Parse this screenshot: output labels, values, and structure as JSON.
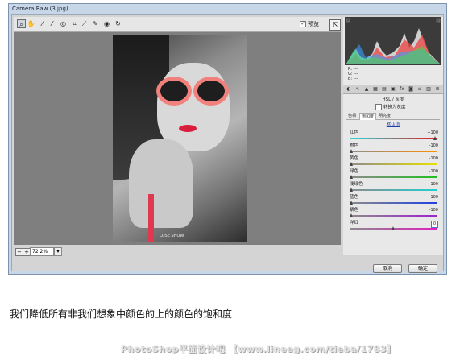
{
  "window": {
    "title": "Camera Raw (3.jpg)"
  },
  "toolbar": {
    "tools": [
      "zoom-tool",
      "hand-tool",
      "white-balance-tool",
      "color-sampler-tool",
      "target-adjust-tool",
      "crop-tool",
      "straighten-tool",
      "red-eye-tool",
      "spot-removal-tool",
      "rotate-tool"
    ],
    "preview_label": "预览",
    "preview_checked": true
  },
  "photo": {
    "caption": "LOSE SHOW"
  },
  "zoom": {
    "value": "72.2%"
  },
  "histogram": {
    "r_label": "R:",
    "g_label": "G:",
    "b_label": "B:",
    "r_value": "---",
    "g_value": "---",
    "b_value": "---"
  },
  "panel": {
    "title": "HSL / 灰度",
    "convert_gray_label": "转换为灰度",
    "subtabs": [
      "色相",
      "饱和度",
      "明亮度"
    ],
    "active_subtab": 1,
    "default_link": "默认值",
    "sliders": [
      {
        "name": "红色",
        "value": "+100",
        "position": 1.0,
        "colors": [
          "#2bd6d6",
          "#e02020"
        ]
      },
      {
        "name": "橙色",
        "value": "-100",
        "position": 0.0,
        "colors": [
          "#8c8c8c",
          "#ff8c00"
        ]
      },
      {
        "name": "黄色",
        "value": "-100",
        "position": 0.0,
        "colors": [
          "#8c8c8c",
          "#e8e000"
        ]
      },
      {
        "name": "绿色",
        "value": "-100",
        "position": 0.0,
        "colors": [
          "#8c8c8c",
          "#20c020"
        ]
      },
      {
        "name": "浅绿色",
        "value": "-100",
        "position": 0.0,
        "colors": [
          "#8c8c8c",
          "#20d0d0"
        ]
      },
      {
        "name": "蓝色",
        "value": "-100",
        "position": 0.0,
        "colors": [
          "#8c8c8c",
          "#2040e0"
        ]
      },
      {
        "name": "紫色",
        "value": "-100",
        "position": 0.0,
        "colors": [
          "#8c8c8c",
          "#a020d0"
        ]
      },
      {
        "name": "洋红",
        "value": "0",
        "position": 0.5,
        "colors": [
          "#8c8c8c",
          "#e020c0"
        ]
      }
    ]
  },
  "buttons": {
    "cancel": "取消",
    "ok": "确定"
  },
  "caption": "我们降低所有非我们想象中颜色的上的颜色的饱和度",
  "watermark": "PhotoShop平面设计吧 【www.lineeg.com/tieba/1783】"
}
